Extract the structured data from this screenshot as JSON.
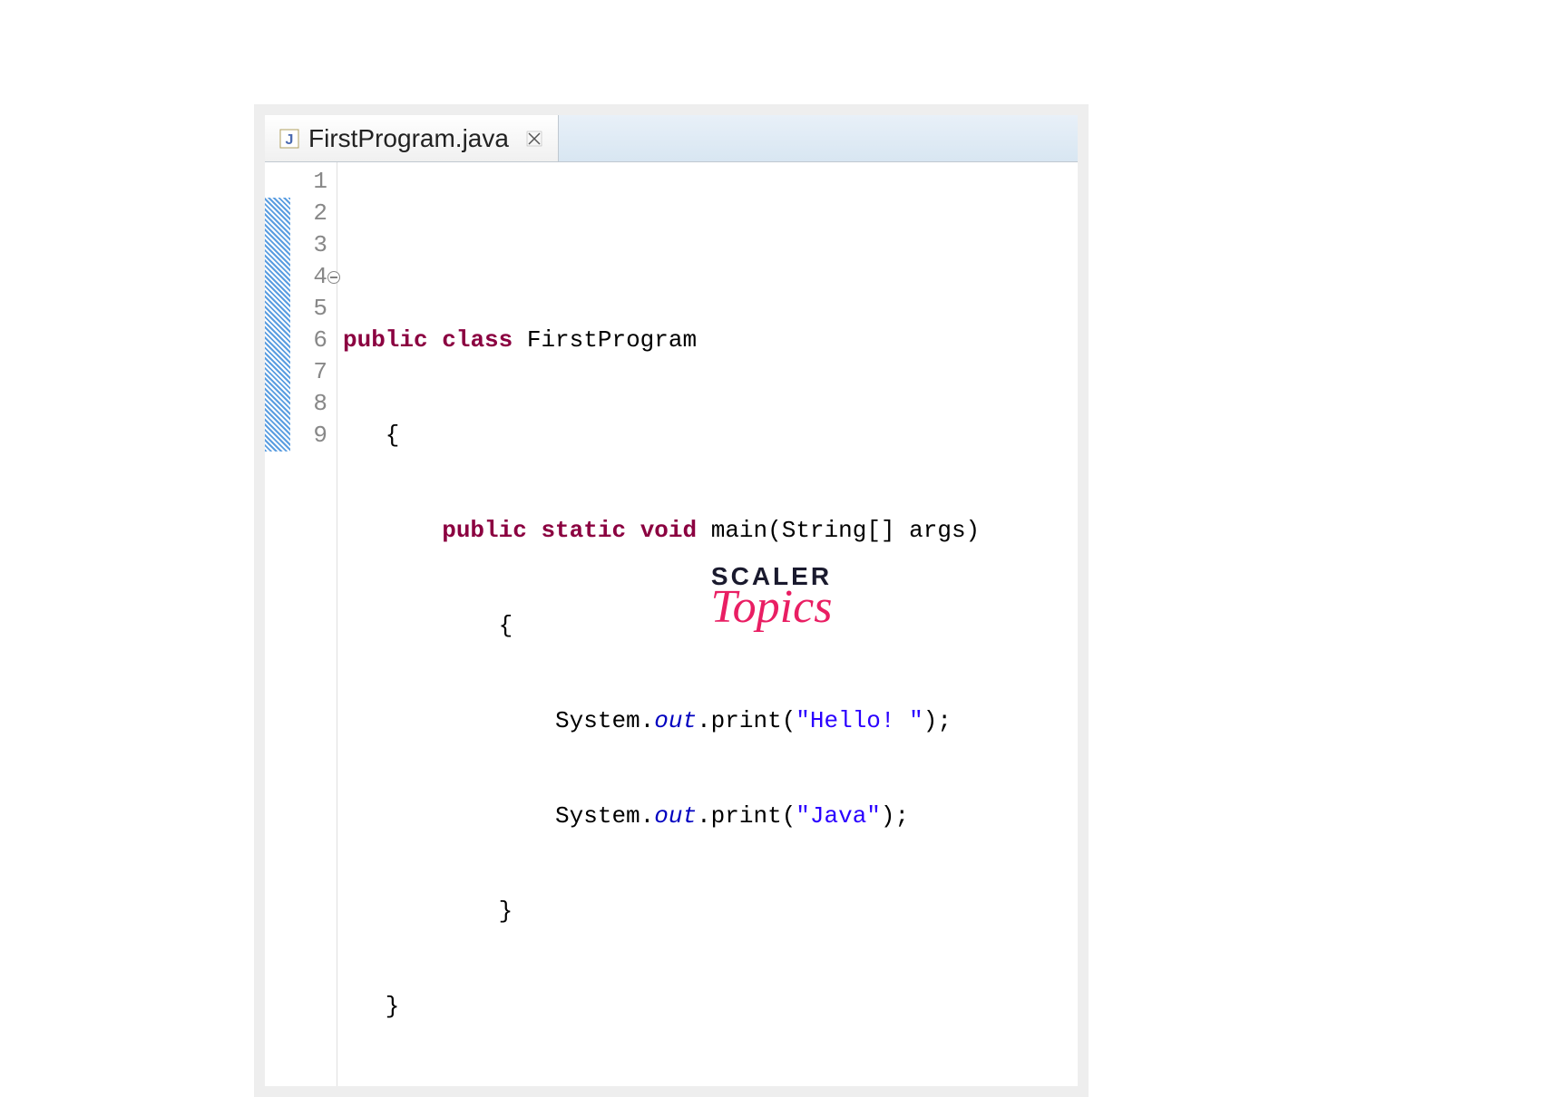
{
  "tab": {
    "filename": "FirstProgram.java"
  },
  "gutter": {
    "lines": [
      "1",
      "2",
      "3",
      "4",
      "5",
      "6",
      "7",
      "8",
      "9"
    ]
  },
  "code": {
    "line1": "",
    "line2": {
      "kw1": "public",
      "kw2": "class",
      "name": " FirstProgram"
    },
    "line3": "   {",
    "line4": {
      "indent": "       ",
      "kw1": "public",
      "kw2": "static",
      "kw3": "void",
      "rest": " main(String[] args)"
    },
    "line5": "           {",
    "line6": {
      "indent": "               ",
      "sys": "System.",
      "out": "out",
      "print": ".print(",
      "str": "\"Hello! \"",
      "end": ");"
    },
    "line7": {
      "indent": "               ",
      "sys": "System.",
      "out": "out",
      "print": ".print(",
      "str": "\"Java\"",
      "end": ");"
    },
    "line8": "           }",
    "line9": "   }"
  },
  "logo": {
    "top": "SCALER",
    "bottom": "Topics"
  }
}
